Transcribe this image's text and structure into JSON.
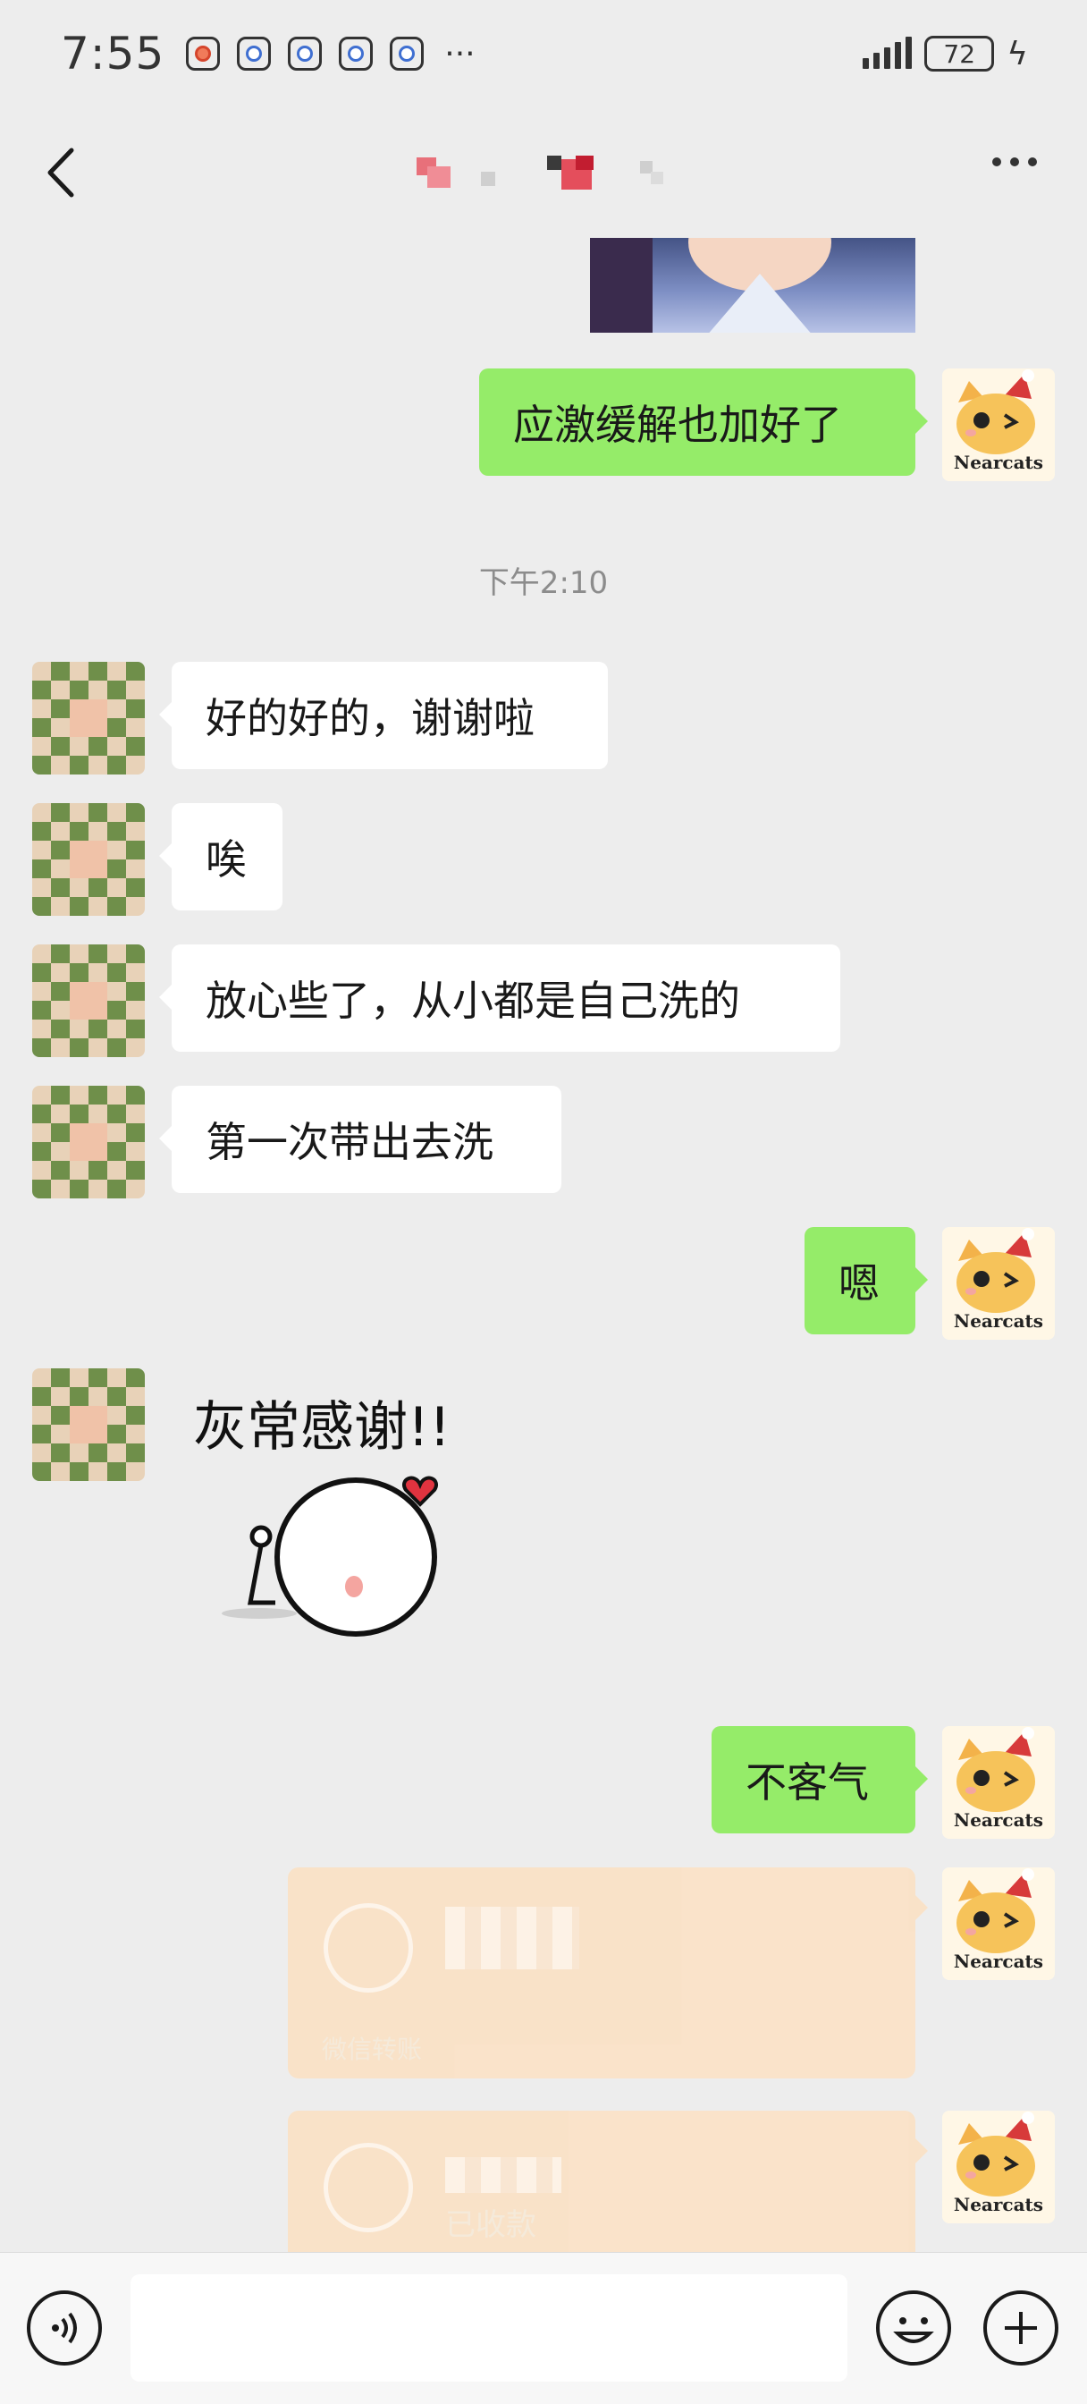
{
  "status_bar": {
    "time": "7:55",
    "battery": "72",
    "more_notifications": "···"
  },
  "header": {
    "title": "",
    "more_label": "···"
  },
  "messages": [
    {
      "side": "right",
      "text": "应激缓解也加好了"
    },
    {
      "side": "left",
      "text": "好的好的，谢谢啦"
    },
    {
      "side": "left",
      "text": "唉"
    },
    {
      "side": "left",
      "text": "放心些了，从小都是自己洗的"
    },
    {
      "side": "left",
      "text": "第一次带出去洗"
    },
    {
      "side": "right",
      "text": "嗯"
    },
    {
      "side": "right",
      "text": "不客气"
    }
  ],
  "timestamp": "下午2:10",
  "sticker": {
    "text": "灰常感谢!!"
  },
  "transfers": [
    {
      "caption": "微信转账"
    },
    {
      "caption": "已收款"
    }
  ],
  "self_avatar_text": "Nearcats",
  "colors": {
    "background": "#ededed",
    "bubble_self": "#95ec69",
    "bubble_other": "#ffffff",
    "transfer": "#fbe1c5"
  }
}
